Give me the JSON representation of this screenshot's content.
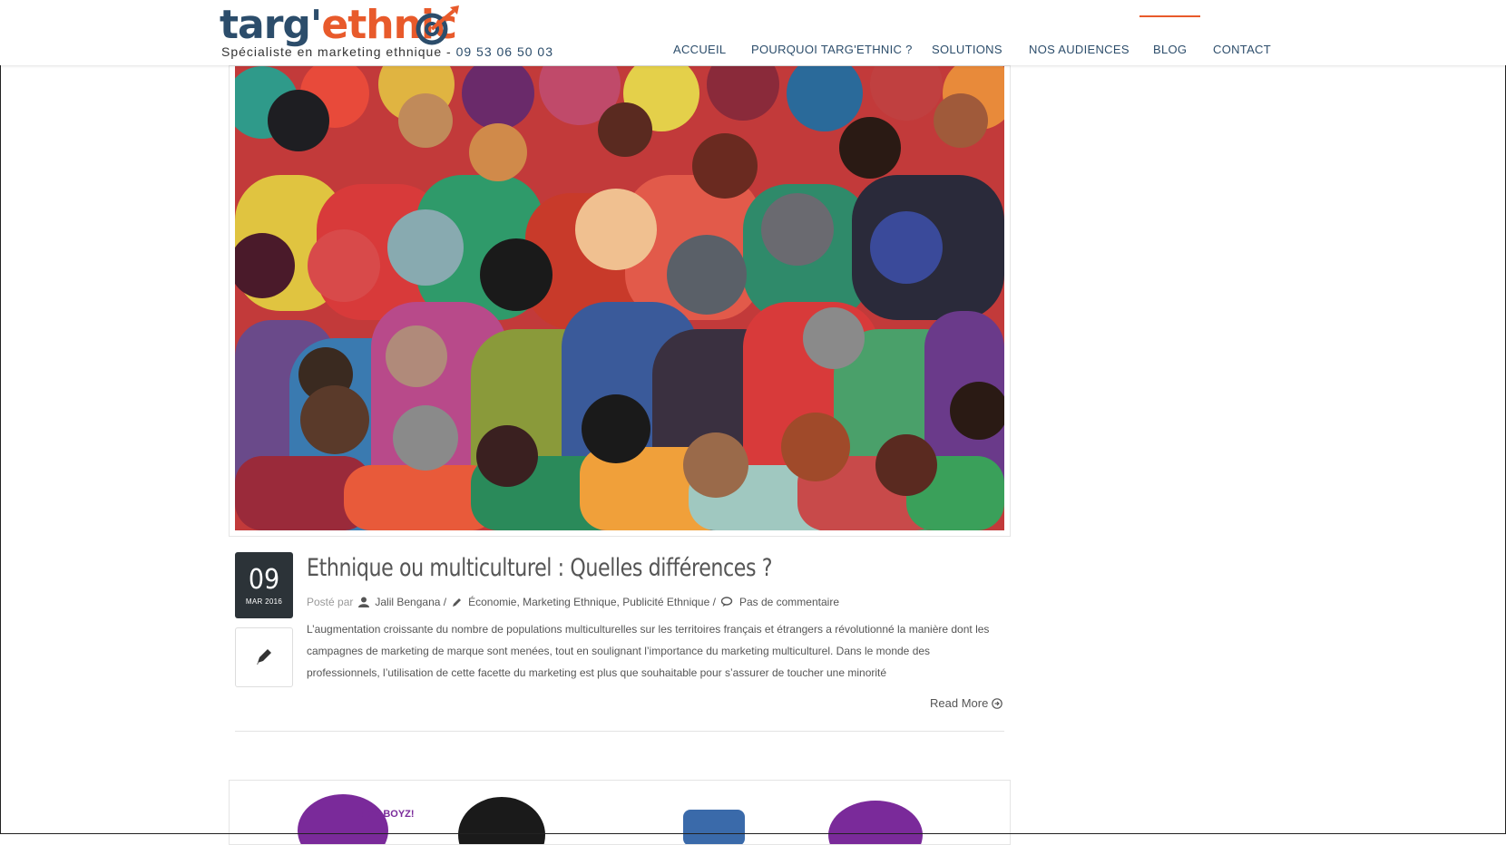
{
  "header": {
    "logo": {
      "part1": "targ'",
      "part2": "ethni",
      "part3": "c"
    },
    "tagline": "Spécialiste en marketing ethnique - ",
    "phone": "09 53 06 50 03",
    "nav": [
      {
        "label": "ACCUEIL",
        "active": false
      },
      {
        "label": "POURQUOI TARG'ETHNIC ?",
        "active": false
      },
      {
        "label": "SOLUTIONS",
        "active": false
      },
      {
        "label": "NOS AUDIENCES",
        "active": false
      },
      {
        "label": "BLOG",
        "active": true
      },
      {
        "label": "CONTACT",
        "active": false
      }
    ]
  },
  "post": {
    "date_day": "09",
    "date_month": "MAR 2016",
    "title": "Ethnique ou multiculturel : Quelles différences ?",
    "posted_by_label": "Posté par",
    "author": "Jalil Bengana /",
    "categories": "Économie, Marketing Ethnique, Publicité Ethnique /",
    "comments": "Pas de commentaire",
    "excerpt": "L’augmentation croissante du nombre de populations multiculturelles sur les territoires français et étrangers a révolutionné la manière dont les campagnes de marketing de marque sont menées, tout en soulignant l’importance du marketing multiculturel.   Dans le monde des professionnels, l’utilisation de cette facette du marketing est plus que souhaitable pour s’assurer de toucher une minorité",
    "read_more": "Read More"
  },
  "next_card": {
    "badge_text": "BIGZ BOYZ!"
  },
  "colors": {
    "brand_dark": "#2c4d6b",
    "brand_orange": "#e85a2b",
    "date_box_bg": "#2c3338"
  },
  "icons": [
    "target-icon",
    "user-icon",
    "pencil-icon",
    "comments-icon",
    "arrow-circle-right-icon",
    "edit-icon"
  ]
}
